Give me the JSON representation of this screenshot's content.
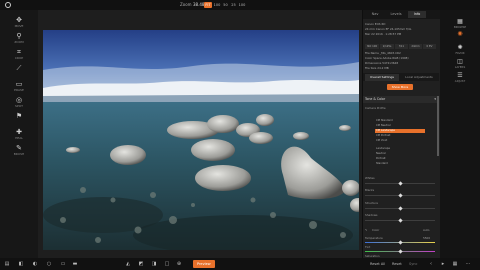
{
  "topbar": {
    "zoom_label": "Zoom",
    "zoom_value": "38.48",
    "zoom_options": [
      "FIT",
      "100",
      "50",
      "25",
      "100"
    ],
    "active_index": 0
  },
  "left_tools": [
    "MOVE",
    "ZOOM",
    "CROP",
    "",
    "ERASE",
    "SPOT",
    "",
    "HEAL",
    "BRUSH",
    ""
  ],
  "right_panel": {
    "tabs": [
      "Nav",
      "Levels",
      "Info"
    ],
    "active_tab": 2,
    "camera": "Canon EOS 6D",
    "lens": "24 mm Canon EF 24-105mm f/4L",
    "date": "Mar 22 2016 · 1:28:57 PM",
    "exposure_chips": [
      "ISO 100",
      "1/125s",
      "f/11",
      "24mm",
      "0 EV"
    ],
    "file_name": "File Name  _MG_4603.CR2",
    "color_space": "Color Space  Adobe RGB (1998)",
    "dimensions": "Dimensions  5472x3648",
    "file_size": "File Size  24.2 MB",
    "subtabs": [
      "Overall Settings",
      "Local Adjustments"
    ],
    "show_more": "Show More",
    "section_title": "Tone & Color",
    "camera_profile_label": "Camera Profile",
    "profile_options": [
      "CM Standard",
      "CM Neutral",
      "CM Landscape",
      "CM Portrait",
      "CM Vivid",
      "Landscape",
      "Neutral",
      "Portrait",
      "Standard"
    ],
    "selected_profile_index": 2,
    "sliders": [
      "Whites",
      "Blacks",
      "Structure",
      "Shadows"
    ],
    "wb_label": "Color",
    "wb_value": "Auto",
    "temperature_label": "Temperature",
    "temperature_value": "5500",
    "tint_label": "Tint",
    "saturation_label": "Saturation"
  },
  "far_tools": [
    "BROWSE",
    "",
    "FAVOR",
    "LAYERS",
    "ADJUST"
  ],
  "bottombar": {
    "preview_label": "Preview",
    "reset_all": "Reset All",
    "reset": "Reset",
    "sync": "Sync"
  },
  "colors": {
    "accent": "#e8712b"
  }
}
